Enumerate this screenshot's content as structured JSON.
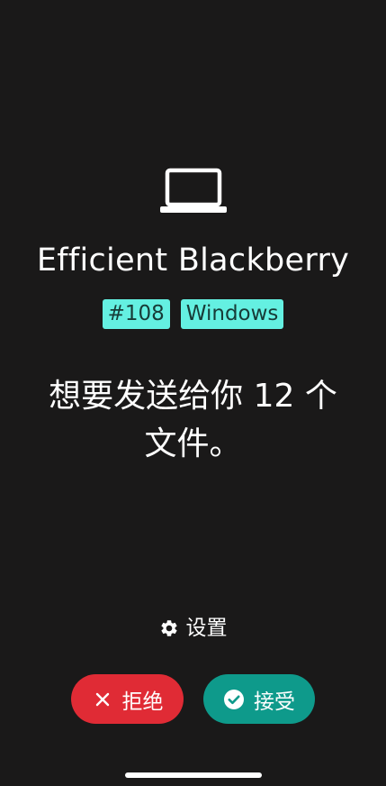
{
  "icons": {
    "device": "laptop-icon",
    "settings": "gear-icon",
    "decline": "close-icon",
    "accept": "check-circle-icon"
  },
  "colors": {
    "background": "#1a1919",
    "badge": "#64f0e1",
    "decline": "#e02b35",
    "accept": "#0e9a8b"
  },
  "device": {
    "name": "Efficient Blackberry",
    "badges": [
      "#108",
      "Windows"
    ]
  },
  "message": {
    "line1": "想要发送给你 12 个",
    "line2": "文件。"
  },
  "settings": {
    "label": "设置"
  },
  "actions": {
    "decline_label": "拒绝",
    "accept_label": "接受"
  }
}
